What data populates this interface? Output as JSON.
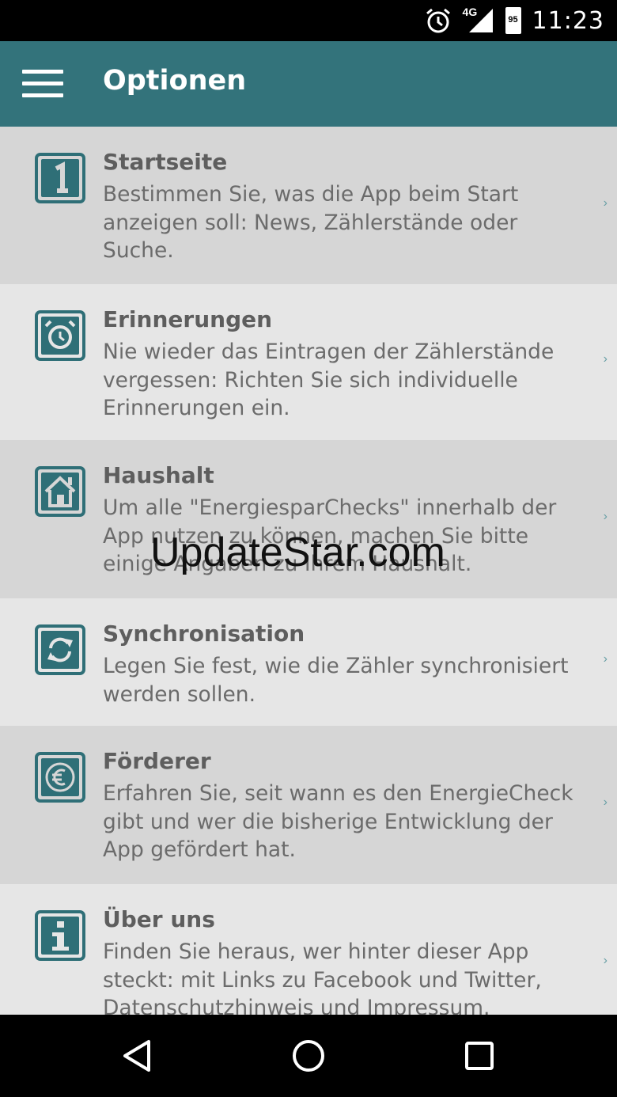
{
  "status_bar": {
    "icons": [
      "alarm-icon",
      "signal-4g-icon",
      "battery-icon"
    ],
    "network": "4G",
    "battery": "95",
    "time": "11:23"
  },
  "app_bar": {
    "title": "Optionen",
    "menu_icon": "hamburger-menu-icon"
  },
  "colors": {
    "accent": "#33737b",
    "icon": "#2f6f77",
    "row_dark": "#d6d6d6",
    "row_light": "#e6e6e6",
    "text": "#6b6b6b"
  },
  "items": [
    {
      "icon": "number-one-icon",
      "title": "Startseite",
      "desc": "Bestimmen Sie, was die App beim Start anzeigen soll: News, Zählerstände oder Suche."
    },
    {
      "icon": "alarm-clock-icon",
      "title": "Erinnerungen",
      "desc": "Nie wieder das Eintragen der Zählerstände vergessen: Richten Sie sich individuelle Erinnerungen ein."
    },
    {
      "icon": "house-icon",
      "title": "Haushalt",
      "desc": "Um alle \"EnergiesparChecks\" innerhalb der App nutzen zu können, machen Sie bitte einige Angaben zu Ihrem Haushalt."
    },
    {
      "icon": "sync-icon",
      "title": "Synchronisation",
      "desc": "Legen Sie fest, wie die Zähler synchronisiert werden sollen."
    },
    {
      "icon": "euro-icon",
      "title": "Förderer",
      "desc": "Erfahren Sie, seit wann es den EnergieCheck gibt und wer die bisherige Entwicklung der App gefördert hat."
    },
    {
      "icon": "info-icon",
      "title": "Über uns",
      "desc": "Finden Sie heraus, wer hinter dieser App steckt: mit Links zu Facebook und Twitter, Datenschutzhinweis und Impressum."
    }
  ],
  "chevron": "›",
  "watermark": "UpdateStar.com",
  "nav_bar": [
    "back-icon",
    "home-icon",
    "recents-icon"
  ]
}
